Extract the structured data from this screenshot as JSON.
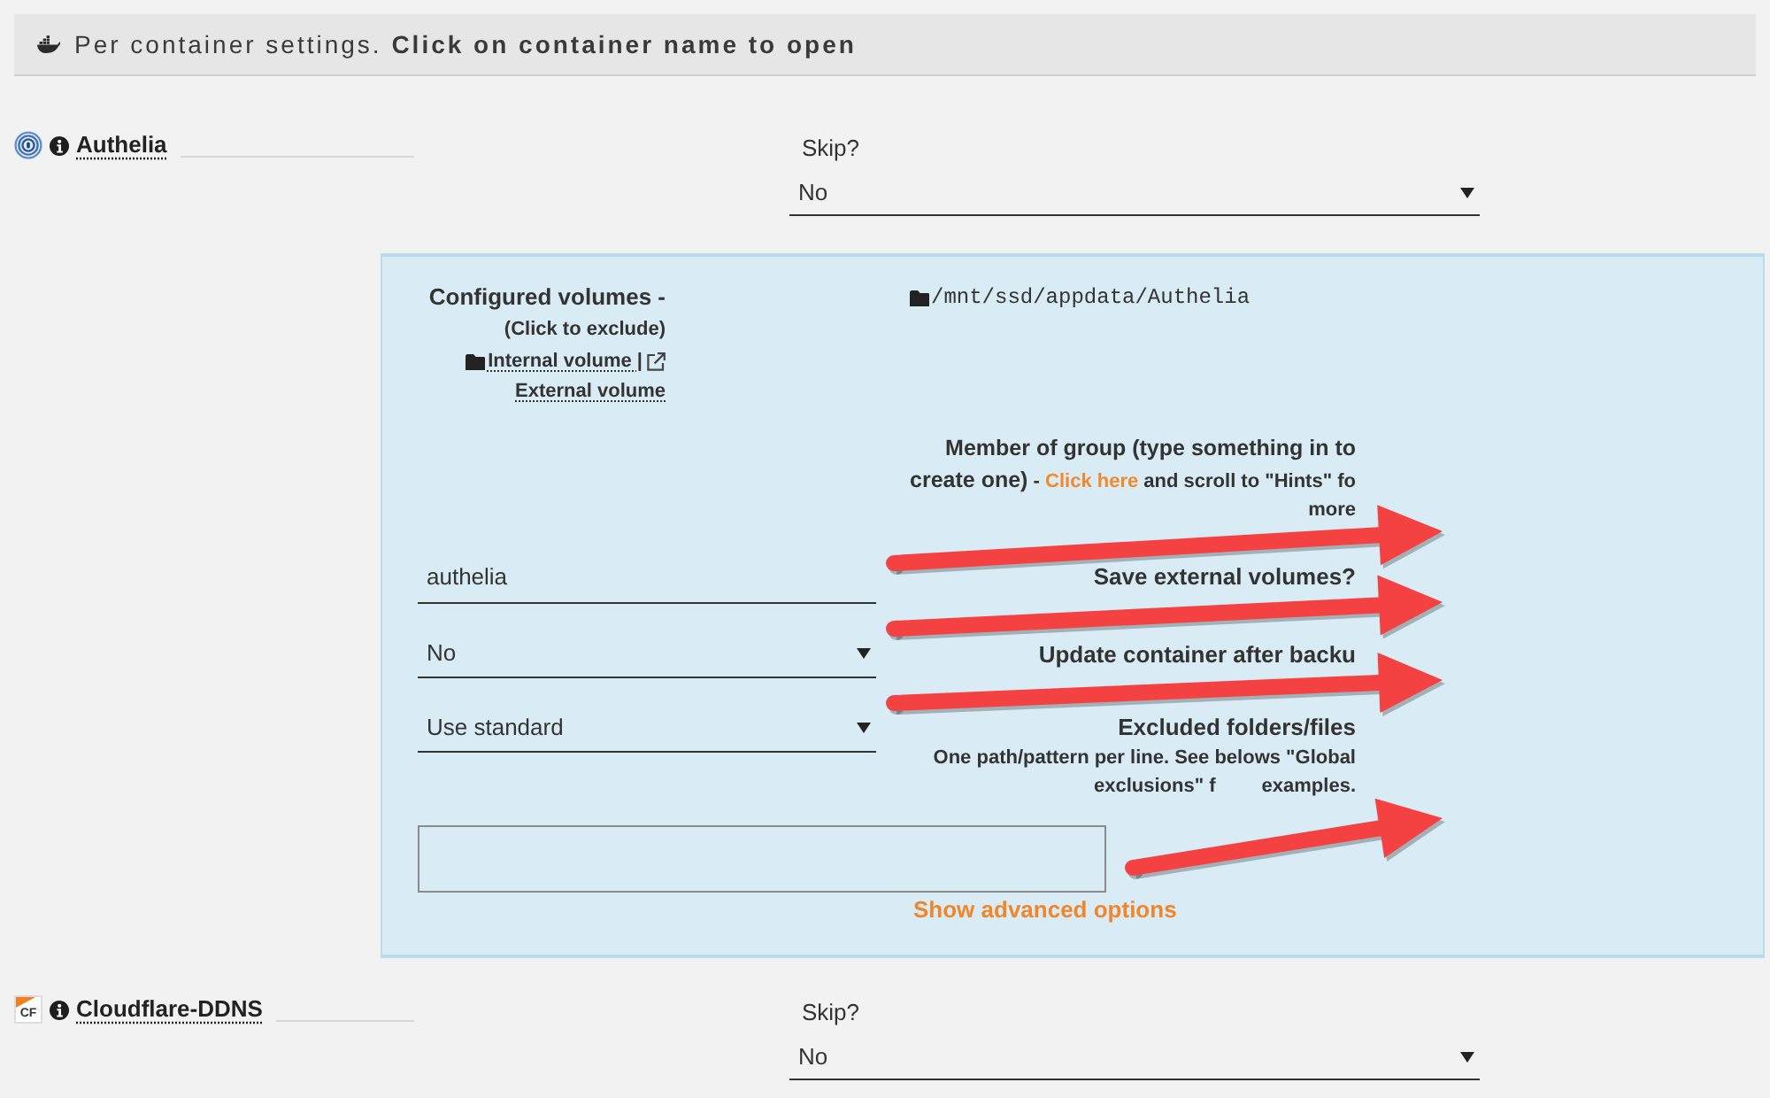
{
  "header": {
    "text": "Per container settings. **Click on container name to open**"
  },
  "containers": [
    {
      "name": "Authelia",
      "logo": {
        "kind": "rings"
      },
      "skip": {
        "label": "Skip?",
        "value": "No"
      },
      "expanded": true,
      "settings": {
        "volumes": {
          "label": "Configured volumes -",
          "hint": "(Click to exclude)",
          "internal_label": "Internal volume |",
          "external_label": "External volume",
          "paths": [
            {
              "kind": "internal",
              "path": "/mnt/ssd/appdata/Authelia"
            }
          ]
        },
        "group": {
          "label": "Member of group (type something in to create one)",
          "hint_start": "-",
          "link": "Click here",
          "hint": "and scroll to \"Hints\" fo",
          "hint_tail": "more",
          "value": "authelia"
        },
        "save_external": {
          "label": "Save external volumes?",
          "value": "No"
        },
        "update_after_backup": {
          "label": "Update container after backu",
          "value": "Use standard"
        },
        "excluded": {
          "label": "Excluded folders/files",
          "hint": "One path/pattern per line. See belows \"Global exclusions\" f",
          "hint_tail": "examples."
        },
        "advanced_link": "Show advanced options"
      }
    },
    {
      "name": "Cloudflare-DDNS",
      "logo": {
        "kind": "tile",
        "text": "CF"
      },
      "skip": {
        "label": "Skip?",
        "value": "No"
      },
      "expanded": false
    }
  ]
}
